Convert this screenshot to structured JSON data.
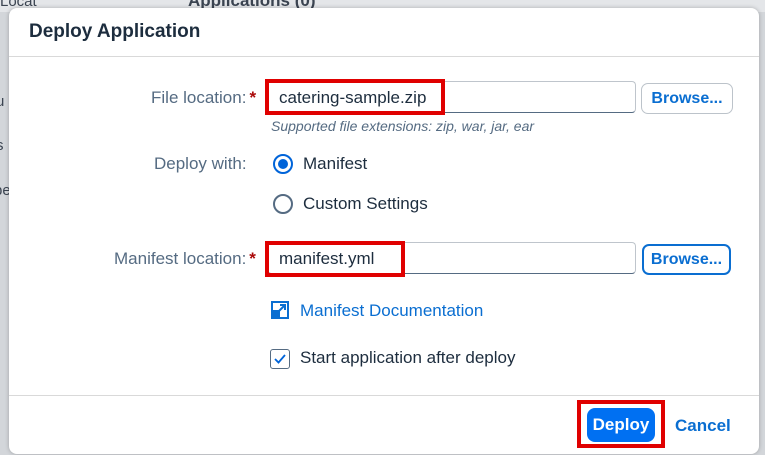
{
  "background": {
    "title": "Applications (0)",
    "crumb": "Locat",
    "side_items": [
      "u",
      "s",
      "pe"
    ]
  },
  "dialog": {
    "title": "Deploy Application",
    "file_location": {
      "label": "File location:",
      "required_mark": "*",
      "value": "catering-sample.zip",
      "browse_label": "Browse...",
      "hint": "Supported file extensions: zip, war, jar, ear"
    },
    "deploy_with": {
      "label": "Deploy with:",
      "options": [
        {
          "label": "Manifest",
          "checked": true
        },
        {
          "label": "Custom Settings",
          "checked": false
        }
      ]
    },
    "manifest_location": {
      "label": "Manifest location:",
      "required_mark": "*",
      "value": "manifest.yml",
      "browse_label": "Browse..."
    },
    "manifest_doc_link": {
      "label": "Manifest Documentation",
      "icon": "external-link-icon"
    },
    "start_after_deploy": {
      "label": "Start application after deploy",
      "checked": true
    },
    "footer": {
      "deploy_label": "Deploy",
      "cancel_label": "Cancel"
    }
  },
  "colors": {
    "accent": "#0070f2",
    "link": "#0a6ed1",
    "highlight": "#e00000",
    "required": "#aa0808"
  }
}
